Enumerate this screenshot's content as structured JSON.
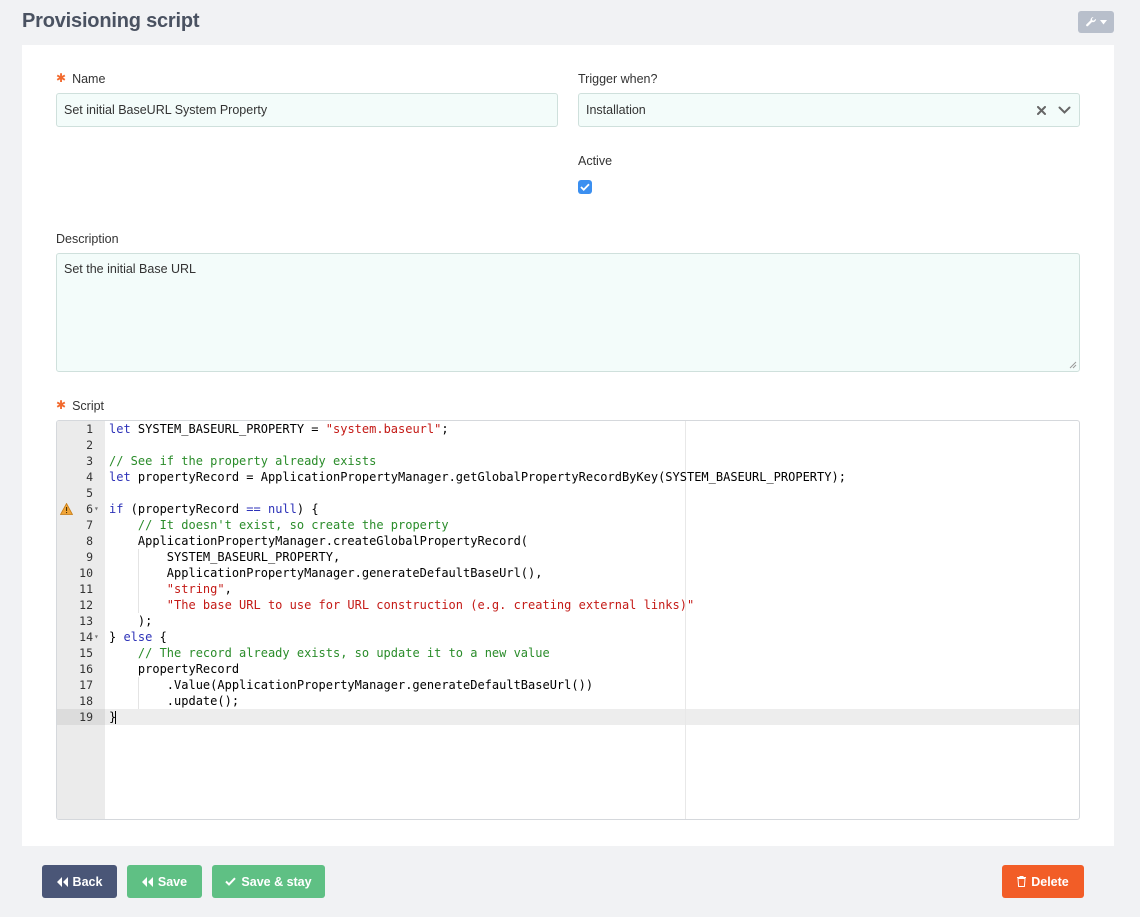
{
  "header": {
    "title": "Provisioning script"
  },
  "form": {
    "name_label": "Name",
    "name_value": "Set initial BaseURL System Property",
    "trigger_label": "Trigger when?",
    "trigger_value": "Installation",
    "active_label": "Active",
    "active_checked": true,
    "description_label": "Description",
    "description_value": "Set the initial Base URL",
    "script_label": "Script",
    "required_marker": "✱"
  },
  "script": {
    "lines": [
      "let SYSTEM_BASEURL_PROPERTY = \"system.baseurl\";",
      "",
      "// See if the property already exists",
      "let propertyRecord = ApplicationPropertyManager.getGlobalPropertyRecordByKey(SYSTEM_BASEURL_PROPERTY);",
      "",
      "if (propertyRecord == null) {",
      "    // It doesn't exist, so create the property",
      "    ApplicationPropertyManager.createGlobalPropertyRecord(",
      "        SYSTEM_BASEURL_PROPERTY,",
      "        ApplicationPropertyManager.generateDefaultBaseUrl(),",
      "        \"string\",",
      "        \"The base URL to use for URL construction (e.g. creating external links)\"",
      "    );",
      "} else {",
      "    // The record already exists, so update it to a new value",
      "    propertyRecord",
      "        .Value(ApplicationPropertyManager.generateDefaultBaseUrl())",
      "        .update();",
      "}"
    ],
    "warning_line": 6,
    "fold_lines": [
      6,
      14
    ],
    "active_line": 19
  },
  "actions": {
    "back_label": "Back",
    "save_label": "Save",
    "save_stay_label": "Save & stay",
    "delete_label": "Delete"
  },
  "colors": {
    "back": "#4a5677",
    "save": "#5fc084",
    "delete": "#f25d27",
    "required": "#f26a2e"
  },
  "icons": {
    "tools": "wrench-icon",
    "clear": "close-icon",
    "dropdown": "chevron-down-icon",
    "warning": "warning-icon",
    "back": "double-chevron-left-icon",
    "save": "double-chevron-left-icon",
    "save_stay": "check-icon",
    "delete": "trash-icon"
  }
}
